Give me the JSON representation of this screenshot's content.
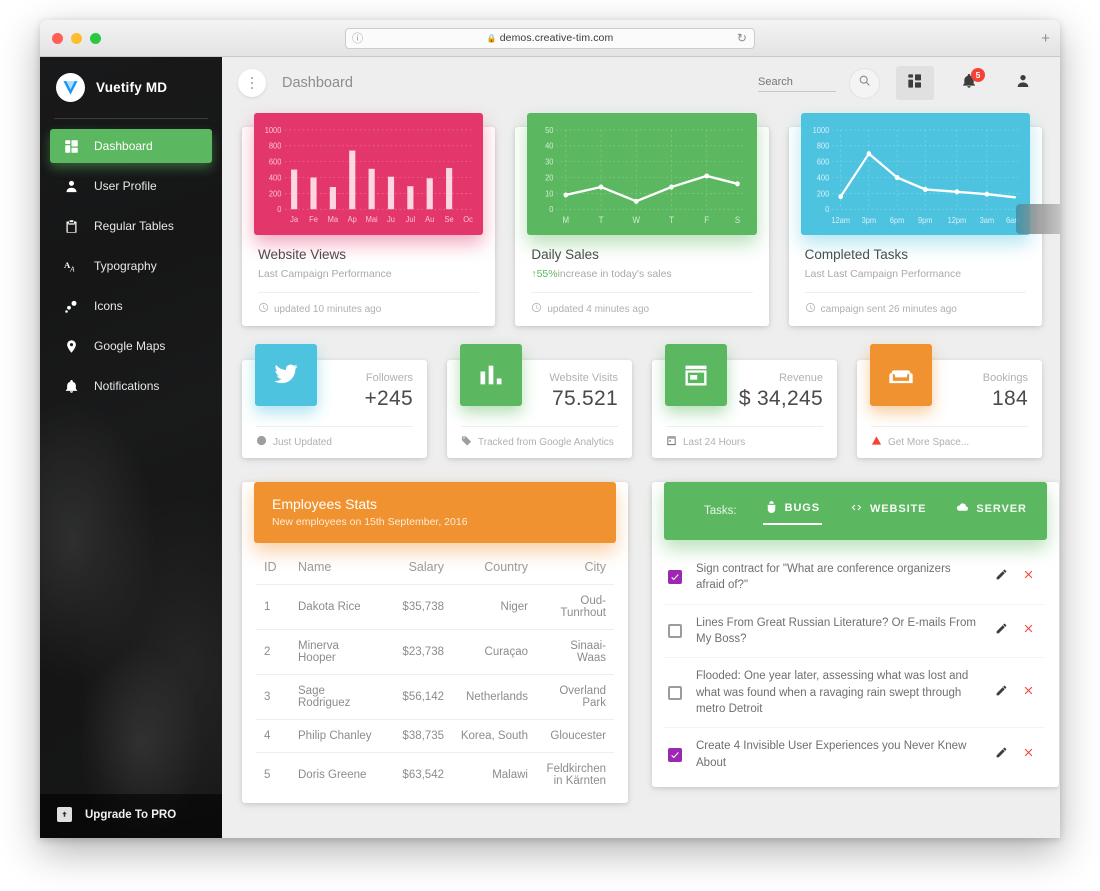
{
  "browser": {
    "url": "demos.creative-tim.com",
    "lock_icon": "lock-icon",
    "reload_icon": "reload-icon",
    "new_tab_label": "+"
  },
  "sidebar": {
    "brand": "Vuetify MD",
    "items": [
      {
        "label": "Dashboard",
        "icon": "dashboard-icon",
        "active": true
      },
      {
        "label": "User Profile",
        "icon": "person-icon",
        "active": false
      },
      {
        "label": "Regular Tables",
        "icon": "clipboard-icon",
        "active": false
      },
      {
        "label": "Typography",
        "icon": "typography-icon",
        "active": false
      },
      {
        "label": "Icons",
        "icon": "bubbles-icon",
        "active": false
      },
      {
        "label": "Google Maps",
        "icon": "map-pin-icon",
        "active": false
      },
      {
        "label": "Notifications",
        "icon": "bell-icon",
        "active": false
      }
    ],
    "upgrade_label": "Upgrade To PRO"
  },
  "header": {
    "title": "Dashboard",
    "menu_icon": "kebab-menu-icon",
    "search_placeholder": "Search",
    "search_value": "",
    "search_icon": "search-icon",
    "apps_icon": "apps-grid-icon",
    "notifications_icon": "bell-icon",
    "notifications_count": "5",
    "account_icon": "person-icon"
  },
  "charts": [
    {
      "title": "Website Views",
      "subtitle": "Last Campaign Performance",
      "footer": "updated 10 minutes ago",
      "footer_icon": "clock-icon",
      "color": "#e3366a"
    },
    {
      "title": "Daily Sales",
      "subtitle_prefix": "55%",
      "subtitle": "increase in today's sales",
      "footer": "updated 4 minutes ago",
      "footer_icon": "clock-icon",
      "color": "#5cb860"
    },
    {
      "title": "Completed Tasks",
      "subtitle": "Last Last Campaign Performance",
      "footer": "campaign sent 26 minutes ago",
      "footer_icon": "clock-icon",
      "color": "#4ec3e0"
    }
  ],
  "chart_data": [
    {
      "type": "bar",
      "title": "Website Views",
      "categories": [
        "Ja",
        "Fe",
        "Ma",
        "Ap",
        "Mai",
        "Ju",
        "Jul",
        "Au",
        "Se",
        "Oc"
      ],
      "values": [
        500,
        400,
        280,
        740,
        510,
        410,
        290,
        390,
        520,
        null
      ],
      "ylim": [
        0,
        1000
      ],
      "yticks": [
        0,
        200,
        400,
        600,
        800,
        1000
      ],
      "xlabel": "",
      "ylabel": "",
      "grid": true,
      "legend": false,
      "bar_color": "#fdd9e3",
      "panel_color": "#e3366a"
    },
    {
      "type": "line",
      "title": "Daily Sales",
      "categories": [
        "M",
        "T",
        "W",
        "T",
        "F",
        "S"
      ],
      "values": [
        9,
        14,
        5,
        14,
        21,
        16
      ],
      "ylim": [
        0,
        50
      ],
      "yticks": [
        0,
        10,
        20,
        30,
        40,
        50
      ],
      "xlabel": "",
      "ylabel": "",
      "grid": true,
      "legend": false,
      "line_color": "#ffffff",
      "panel_color": "#5cb860"
    },
    {
      "type": "line",
      "title": "Completed Tasks",
      "categories": [
        "12am",
        "3pm",
        "6pm",
        "9pm",
        "12pm",
        "3am",
        "6am"
      ],
      "values": [
        160,
        700,
        400,
        250,
        220,
        190,
        150
      ],
      "ylim": [
        0,
        1000
      ],
      "yticks": [
        0,
        200,
        400,
        600,
        800,
        1000
      ],
      "xlabel": "",
      "ylabel": "",
      "grid": true,
      "legend": false,
      "line_color": "#ffffff",
      "panel_color": "#4ec3e0"
    }
  ],
  "stats": [
    {
      "label": "Followers",
      "value": "+245",
      "footer": "Just Updated",
      "icon": "twitter-icon",
      "footer_icon": "clock-icon",
      "color": "#4ec3e0"
    },
    {
      "label": "Website Visits",
      "value": "75.521",
      "footer": "Tracked from Google Analytics",
      "icon": "bar-chart-icon",
      "footer_icon": "tag-icon",
      "color": "#5cb860"
    },
    {
      "label": "Revenue",
      "value": "$ 34,245",
      "footer": "Last 24 Hours",
      "icon": "store-icon",
      "footer_icon": "calendar-icon",
      "color": "#5cb860"
    },
    {
      "label": "Bookings",
      "value": "184",
      "footer": "Get More Space...",
      "icon": "sofa-icon",
      "footer_icon": "warning-icon",
      "color": "#f0922f"
    }
  ],
  "employees": {
    "title": "Employees Stats",
    "subtitle": "New employees on 15th September, 2016",
    "columns": [
      "ID",
      "Name",
      "Salary",
      "Country",
      "City"
    ],
    "rows": [
      {
        "id": "1",
        "name": "Dakota Rice",
        "salary": "$35,738",
        "country": "Niger",
        "city": "Oud-Tunrhout"
      },
      {
        "id": "2",
        "name": "Minerva Hooper",
        "salary": "$23,738",
        "country": "Curaçao",
        "city": "Sinaai-Waas"
      },
      {
        "id": "3",
        "name": "Sage Rodriguez",
        "salary": "$56,142",
        "country": "Netherlands",
        "city": "Overland Park"
      },
      {
        "id": "4",
        "name": "Philip Chanley",
        "salary": "$38,735",
        "country": "Korea, South",
        "city": "Gloucester"
      },
      {
        "id": "5",
        "name": "Doris Greene",
        "salary": "$63,542",
        "country": "Malawi",
        "city": "Feldkirchen in Kärnten"
      }
    ]
  },
  "tasks": {
    "label": "Tasks:",
    "tabs": [
      {
        "label": "BUGS",
        "icon": "bug-icon",
        "active": true
      },
      {
        "label": "WEBSITE",
        "icon": "code-icon",
        "active": false
      },
      {
        "label": "SERVER",
        "icon": "cloud-icon",
        "active": false
      }
    ],
    "edit_icon": "pencil-icon",
    "delete_icon": "close-icon",
    "items": [
      {
        "text": "Sign contract for \"What are conference organizers afraid of?\"",
        "checked": true
      },
      {
        "text": "Lines From Great Russian Literature? Or E-mails From My Boss?",
        "checked": false
      },
      {
        "text": "Flooded: One year later, assessing what was lost and what was found when a ravaging rain swept through metro Detroit",
        "checked": false
      },
      {
        "text": "Create 4 Invisible User Experiences you Never Knew About",
        "checked": true
      }
    ]
  },
  "colors": {
    "pink": "#e3366a",
    "green": "#5cb860",
    "cyan": "#4ec3e0",
    "orange": "#f0922f",
    "purple": "#9c27b0",
    "red": "#f44336",
    "sidebar": "#1f2225"
  }
}
